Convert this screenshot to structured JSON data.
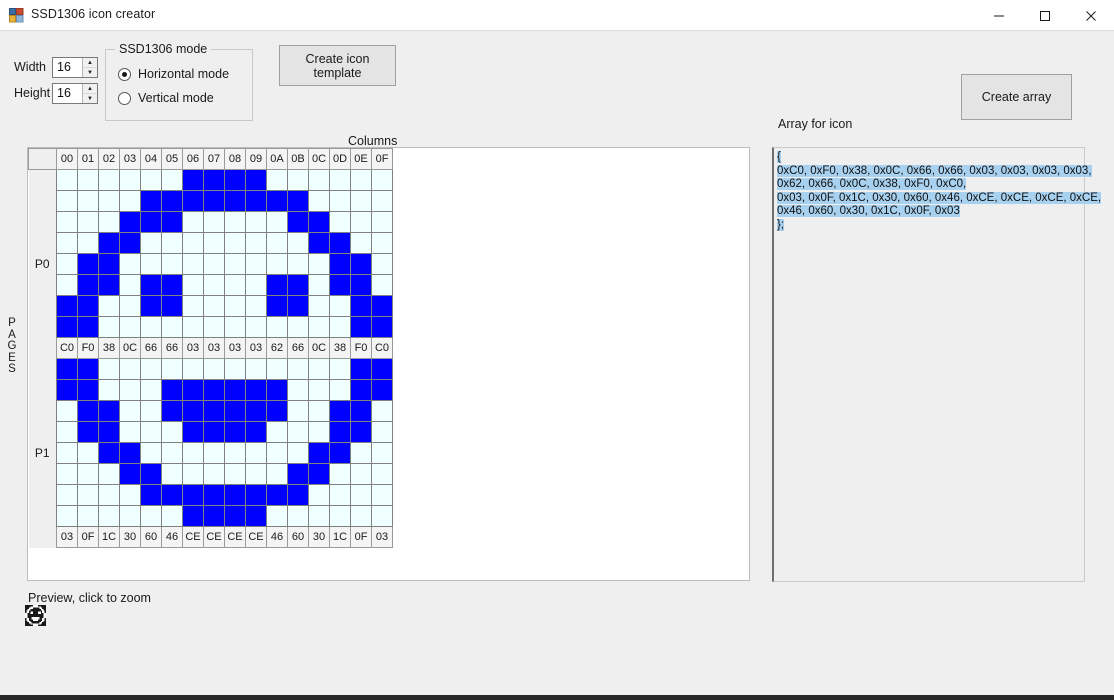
{
  "window": {
    "title": "SSD1306 icon creator",
    "icon": "app-window-icon",
    "minimize_label": "—",
    "maximize_label": "□",
    "close_label": "✕"
  },
  "controls": {
    "width_label": "Width",
    "width_value": "16",
    "height_label": "Height",
    "height_value": "16",
    "spin_up": "▲",
    "spin_down": "▼",
    "groupbox_title": "SSD1306 mode",
    "mode_horizontal": "Horizontal mode",
    "mode_vertical": "Vertical mode",
    "mode_selected": "Horizontal mode",
    "create_template_button": "Create icon template",
    "create_array_button": "Create array"
  },
  "labels": {
    "columns": "Columns",
    "pages": "PAGES",
    "pages_letters": [
      "P",
      "A",
      "G",
      "E",
      "S"
    ],
    "array_for_icon": "Array for icon",
    "preview": "Preview, click to zoom"
  },
  "grid": {
    "column_headers": [
      "00",
      "01",
      "02",
      "03",
      "04",
      "05",
      "06",
      "07",
      "08",
      "09",
      "0A",
      "0B",
      "0C",
      "0D",
      "0E",
      "0F"
    ],
    "page_labels": [
      "P0",
      "P1"
    ],
    "page0_hex": [
      "C0",
      "F0",
      "38",
      "0C",
      "66",
      "66",
      "03",
      "03",
      "03",
      "03",
      "62",
      "66",
      "0C",
      "38",
      "F0",
      "C0"
    ],
    "page1_hex": [
      "03",
      "0F",
      "1C",
      "30",
      "60",
      "46",
      "CE",
      "CE",
      "CE",
      "CE",
      "46",
      "60",
      "30",
      "1C",
      "0F",
      "03"
    ],
    "page0_rows": [
      [
        0,
        0,
        0,
        0,
        0,
        0,
        1,
        1,
        1,
        1,
        0,
        0,
        0,
        0,
        0,
        0
      ],
      [
        0,
        0,
        0,
        0,
        1,
        1,
        1,
        1,
        1,
        1,
        1,
        1,
        0,
        0,
        0,
        0
      ],
      [
        0,
        0,
        0,
        1,
        1,
        1,
        0,
        0,
        0,
        0,
        0,
        1,
        1,
        0,
        0,
        0
      ],
      [
        0,
        0,
        1,
        1,
        0,
        0,
        0,
        0,
        0,
        0,
        0,
        0,
        1,
        1,
        0,
        0
      ],
      [
        0,
        1,
        1,
        0,
        0,
        0,
        0,
        0,
        0,
        0,
        0,
        0,
        0,
        1,
        1,
        0
      ],
      [
        0,
        1,
        1,
        0,
        1,
        1,
        0,
        0,
        0,
        0,
        1,
        1,
        0,
        1,
        1,
        0
      ],
      [
        1,
        1,
        0,
        0,
        1,
        1,
        0,
        0,
        0,
        0,
        1,
        1,
        0,
        0,
        1,
        1
      ],
      [
        1,
        1,
        0,
        0,
        0,
        0,
        0,
        0,
        0,
        0,
        0,
        0,
        0,
        0,
        1,
        1
      ]
    ],
    "page1_rows": [
      [
        1,
        1,
        0,
        0,
        0,
        0,
        0,
        0,
        0,
        0,
        0,
        0,
        0,
        0,
        1,
        1
      ],
      [
        1,
        1,
        0,
        0,
        0,
        1,
        1,
        1,
        1,
        1,
        1,
        0,
        0,
        0,
        1,
        1
      ],
      [
        0,
        1,
        1,
        0,
        0,
        1,
        1,
        1,
        1,
        1,
        1,
        0,
        0,
        1,
        1,
        0
      ],
      [
        0,
        1,
        1,
        0,
        0,
        0,
        1,
        1,
        1,
        1,
        0,
        0,
        0,
        1,
        1,
        0
      ],
      [
        0,
        0,
        1,
        1,
        0,
        0,
        0,
        0,
        0,
        0,
        0,
        0,
        1,
        1,
        0,
        0
      ],
      [
        0,
        0,
        0,
        1,
        1,
        0,
        0,
        0,
        0,
        0,
        0,
        1,
        1,
        0,
        0,
        0
      ],
      [
        0,
        0,
        0,
        0,
        1,
        1,
        1,
        1,
        1,
        1,
        1,
        1,
        0,
        0,
        0,
        0
      ],
      [
        0,
        0,
        0,
        0,
        0,
        0,
        1,
        1,
        1,
        1,
        0,
        0,
        0,
        0,
        0,
        0
      ]
    ],
    "cell_on_color": "#0000FF",
    "cell_off_color": "#F0FFFF",
    "cell_border_color": "#808080"
  },
  "array_output": {
    "lines": [
      {
        "text": "{",
        "selected": true
      },
      {
        "text": "0xC0, 0xF0, 0x38, 0x0C, 0x66, 0x66, 0x03, 0x03, 0x03, 0x03,",
        "selected": true
      },
      {
        "text": "0x62, 0x66, 0x0C, 0x38, 0xF0, 0xC0,",
        "selected": true
      },
      {
        "text": "0x03, 0x0F, 0x1C, 0x30, 0x60, 0x46, 0xCE, 0xCE, 0xCE, 0xCE,",
        "selected": true
      },
      {
        "text": "0x46, 0x60, 0x30, 0x1C, 0x0F, 0x03",
        "selected": true
      },
      {
        "text": "};",
        "selected": true
      }
    ],
    "selection_color": "#A8D1EF"
  },
  "preview": {
    "icon_name": "smiley-face-preview-icon",
    "size": "16x16"
  },
  "theme": {
    "window_background": "#EFEFEF",
    "titlebar_background": "#FFFFFF",
    "button_face": "#E4E4E4"
  }
}
